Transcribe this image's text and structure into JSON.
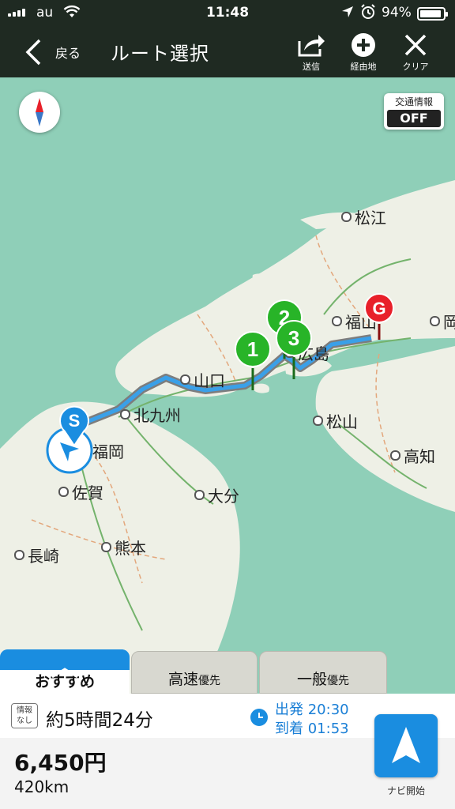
{
  "status_bar": {
    "carrier": "au",
    "time": "11:48",
    "battery": "94%",
    "battery_level": 0.94
  },
  "nav_bar": {
    "back_label": "戻る",
    "title": "ルート選択",
    "send_label": "送信",
    "waypoint_label": "経由地",
    "clear_label": "クリア"
  },
  "map": {
    "traffic_label": "交通情報",
    "traffic_value": "OFF",
    "cities": {
      "matsue": "松江",
      "fukuyama": "福山",
      "oka": "岡",
      "hiroshima": "広島",
      "yamaguchi": "山口",
      "kitakyushu": "北九州",
      "fukuoka": "福岡",
      "matsuyama": "松山",
      "kochi": "高知",
      "saga": "佐賀",
      "oita": "大分",
      "nagasaki": "長崎",
      "kumamoto": "熊本"
    },
    "markers": {
      "start": "S",
      "goal": "G",
      "wp1": "1",
      "wp2": "2",
      "wp3": "3"
    },
    "colors": {
      "route": "#3aa0e8",
      "waypoint": "#28b428",
      "start": "#1a8de0",
      "goal": "#e8202a"
    }
  },
  "tabs": {
    "recommended": "おすすめ",
    "highway_main": "高速",
    "highway_small": "優先",
    "general_main": "一般",
    "general_small": "優先"
  },
  "route_info": {
    "no_info_line1": "情報",
    "no_info_line2": "なし",
    "duration": "約5時間24分",
    "departure": "出発 20:30",
    "arrival": "到着 01:53",
    "price": "6,450円",
    "distance": "420km",
    "navi_start_label": "ナビ開始"
  }
}
